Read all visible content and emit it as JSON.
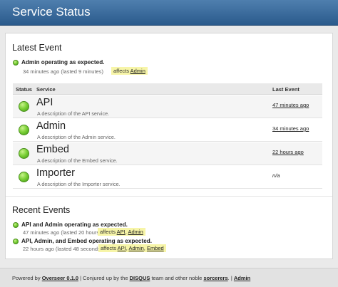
{
  "header": {
    "title": "Service Status"
  },
  "latest": {
    "heading": "Latest Event",
    "event": {
      "title": "Admin operating as expected.",
      "meta": "34 minutes ago (lasted 9 minutes)",
      "affects_label": "affects",
      "services": [
        "Admin"
      ]
    }
  },
  "table": {
    "headers": {
      "status": "Status",
      "service": "Service",
      "last_event": "Last Event"
    },
    "rows": [
      {
        "name": "API",
        "description": "A description of the API service.",
        "last_event": "47 minutes ago",
        "status": "up"
      },
      {
        "name": "Admin",
        "description": "A description of the Admin service.",
        "last_event": "34 minutes ago",
        "status": "up"
      },
      {
        "name": "Embed",
        "description": "A description of the Embed service.",
        "last_event": "22 hours ago",
        "status": "up"
      },
      {
        "name": "Importer",
        "description": "A description of the Importer service.",
        "last_event": "n/a",
        "status": "up"
      }
    ]
  },
  "recent": {
    "heading": "Recent Events",
    "events": [
      {
        "title": "API and Admin operating as expected.",
        "meta": "47 minutes ago (lasted 20 hours)",
        "affects_label": "affects",
        "services": [
          "API",
          "Admin"
        ]
      },
      {
        "title": "API, Admin, and Embed operating as expected.",
        "meta": "22 hours ago (lasted 48 seconds)",
        "affects_label": "affects",
        "services": [
          "API",
          "Admin",
          "Embed"
        ]
      }
    ]
  },
  "footer": {
    "powered_by": "Powered by",
    "overseer_link": "Overseer 0.1.0",
    "conjured": "| Conjured up by the",
    "disqus_link": "DISQUS",
    "team_text": "team and other noble",
    "sorcerers_link": "sorcerers",
    "period": ".",
    "sep": "|",
    "admin_link": "Admin"
  },
  "colors": {
    "header_bg": "#2a5a8c",
    "status_up": "#7fd23a",
    "highlight": "#f7f5a8"
  }
}
